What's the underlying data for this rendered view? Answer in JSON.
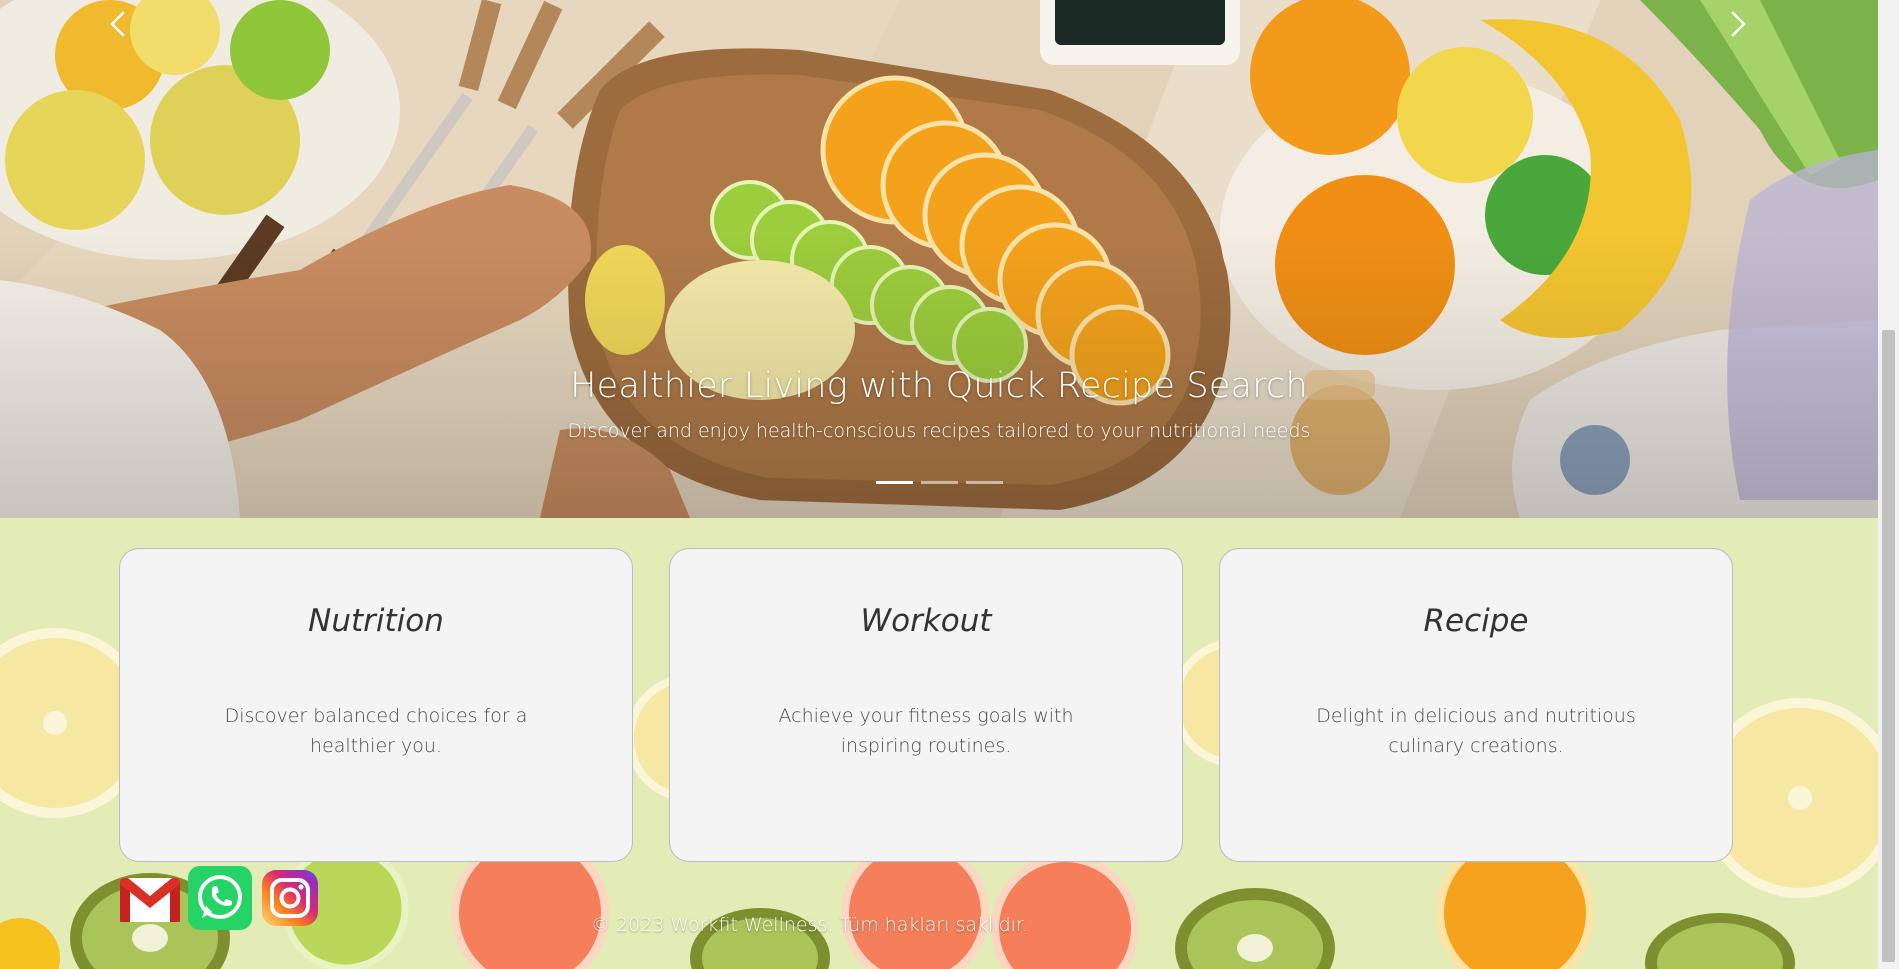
{
  "hero": {
    "title": "Healthier Living with Quick Recipe Search",
    "subtitle": "Discover and enjoy health-conscious recipes tailored to your nutritional needs",
    "slide_count": 3,
    "active_slide": 1,
    "prev_icon": "chevron-left-icon",
    "next_icon": "chevron-right-icon"
  },
  "cards": [
    {
      "title": "Nutrition",
      "text": "Discover balanced choices for a healthier you."
    },
    {
      "title": "Workout",
      "text": "Achieve your fitness goals with inspiring routines."
    },
    {
      "title": "Recipe",
      "text": "Delight in delicious and nutritious culinary creations."
    }
  ],
  "social": [
    {
      "name": "gmail-icon"
    },
    {
      "name": "whatsapp-icon"
    },
    {
      "name": "instagram-icon"
    }
  ],
  "footer": {
    "copyright": "© 2023 Workfit Wellness. Tüm hakları saklıdır."
  },
  "colors": {
    "card_background": "#f4f4f4",
    "card_border": "#b9bcc4",
    "fruit_background": "#e4ecb8",
    "whatsapp_green": "#25d366",
    "gmail_red": "#d93025"
  }
}
